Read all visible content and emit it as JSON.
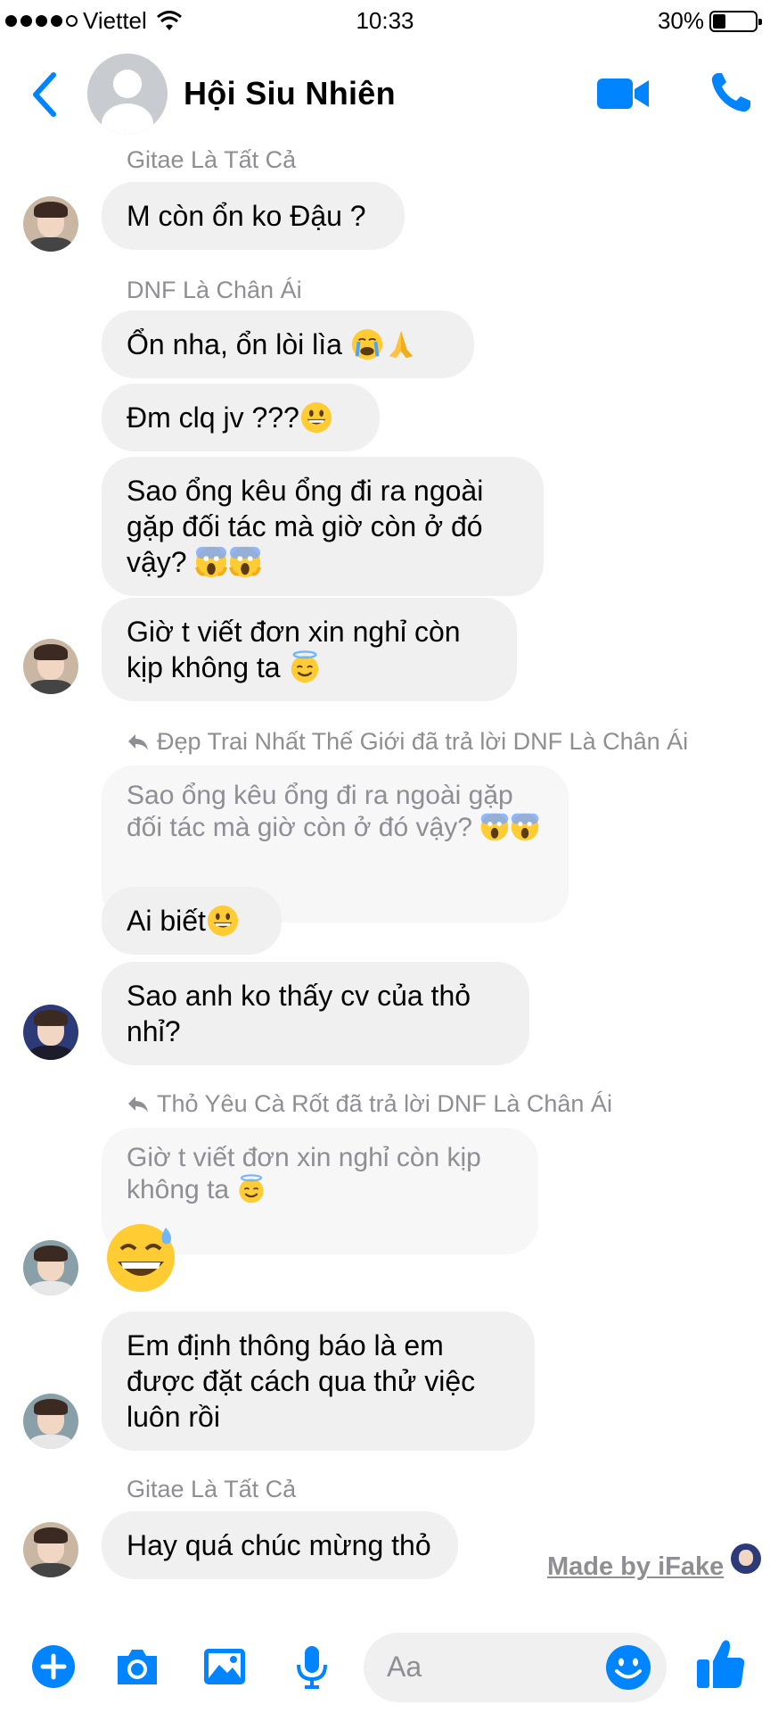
{
  "status_bar": {
    "carrier": "Viettel",
    "time": "10:33",
    "battery": "30%",
    "battery_level": 0.3
  },
  "header": {
    "title": "Hội Siu Nhiên",
    "back_icon": "chevron-left-icon",
    "video_icon": "video-camera-icon",
    "call_icon": "phone-icon",
    "accent_color": "#0084ff"
  },
  "messages": {
    "sender_1": "Gitae Là Tất Cả",
    "msg_1": "M còn ổn ko Đậu ?",
    "sender_2": "DNF Là Chân Ái",
    "msg_2": "Ổn nha, ổn lòi lìa",
    "msg_3": "Đm clq jv ???",
    "msg_4": "Sao ổng kêu ổng đi ra ngoài gặp đối tác mà giờ còn ở đó vậy?",
    "msg_5": "Giờ t viết đơn xin nghỉ còn kịp không ta",
    "reply_label_1": "Đẹp Trai Nhất Thế Giới đã trả lời DNF Là Chân Ái",
    "quoted_1": "Sao ổng kêu ổng đi ra ngoài gặp đối tác mà giờ còn ở đó vậy?",
    "msg_6": "Ai biết",
    "msg_7": "Sao anh ko thấy cv của thỏ nhỉ?",
    "reply_label_2": "Thỏ Yêu Cà Rốt đã trả lời DNF Là Chân Ái",
    "quoted_2": "Giờ t viết đơn xin nghỉ còn kịp không ta",
    "msg_8": "Em định thông báo là em được đặt cách qua thử việc luôn rồi",
    "sender_3": "Gitae Là Tất Cả",
    "msg_9": "Hay quá chúc mừng thỏ"
  },
  "watermark": "Made by iFake",
  "composer": {
    "placeholder": "Aa",
    "icons": [
      "plus-icon",
      "camera-icon",
      "image-icon",
      "microphone-icon",
      "smile-icon",
      "thumbs-up-icon"
    ]
  },
  "colors": {
    "bubble": "#f1f0f0",
    "meta_text": "#8e8e93",
    "accent": "#0084ff"
  }
}
